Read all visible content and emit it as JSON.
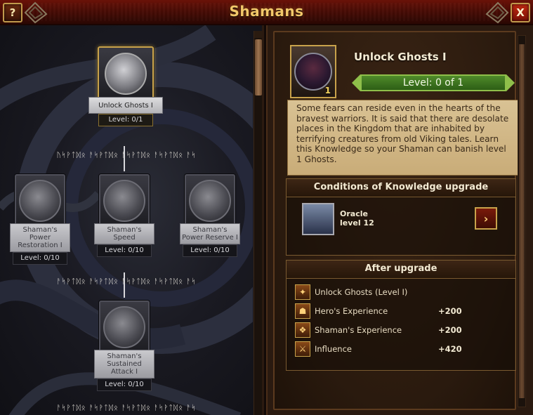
{
  "window": {
    "title": "Shamans",
    "help_label": "?",
    "close_label": "X"
  },
  "tree": {
    "nodes": [
      {
        "name": "Unlock Ghosts I",
        "level": "Level: 0/1"
      },
      {
        "name": "Shaman's Power Restoration I",
        "level": "Level: 0/10"
      },
      {
        "name": "Shaman's Speed",
        "level": "Level: 0/10"
      },
      {
        "name": "Shaman's Power Reserve I",
        "level": "Level: 0/10"
      },
      {
        "name": "Shaman's Sustained Attack I",
        "level": "Level: 0/10"
      }
    ],
    "rune_row_1": "ᚢᛋᚹᛏᛞᛟ ᚨᛋᚹᛏᛞᛟ ᚨᛋᚹᛏᛞᛟ ᚨᛋᚹᛏᛞᛟ ᚨᛋ",
    "rune_row_2": "ᚨᛋᚹᛏᛞᛟ ᚨᛋᚹᛏᛞᛟ ᚨᛋᚹᛏᛞᛟ ᚨᛋᚹᛏᛞᛟ ᚨᛋ",
    "rune_row_3": "ᚨᛋᚹᛏᛞᛟ ᚨᛋᚹᛏᛞᛟ ᚨᛋᚹᛏᛞᛟ ᚨᛋᚹᛏᛞᛟ ᚨᛋ"
  },
  "detail": {
    "title": "Unlock Ghosts I",
    "portrait_number": "1",
    "level_banner": "Level: 0 of 1",
    "description": "Some fears can reside even in the hearts of the bravest warriors. It is said that there are desolate places in the Kingdom that are inhabited by terrifying creatures from old Viking tales. Learn this Knowledge so your Shaman can banish level 1 Ghosts.",
    "conditions": {
      "heading": "Conditions of Knowledge upgrade",
      "building": "Oracle",
      "level": "level 12",
      "go_label": "›"
    },
    "after": {
      "heading": "After upgrade",
      "rewards": [
        {
          "name": "Unlock Ghosts (Level I)",
          "value": "",
          "icon": "ghost-unlock-icon"
        },
        {
          "name": "Hero's Experience",
          "value": "+200",
          "icon": "hero-experience-icon"
        },
        {
          "name": "Shaman's Experience",
          "value": "+200",
          "icon": "shaman-experience-icon"
        },
        {
          "name": "Influence",
          "value": "+420",
          "icon": "influence-icon"
        }
      ]
    }
  },
  "colors": {
    "title": "#f3c86a",
    "level_green": "#4f8a2a",
    "gold_border": "#c8a24b"
  }
}
